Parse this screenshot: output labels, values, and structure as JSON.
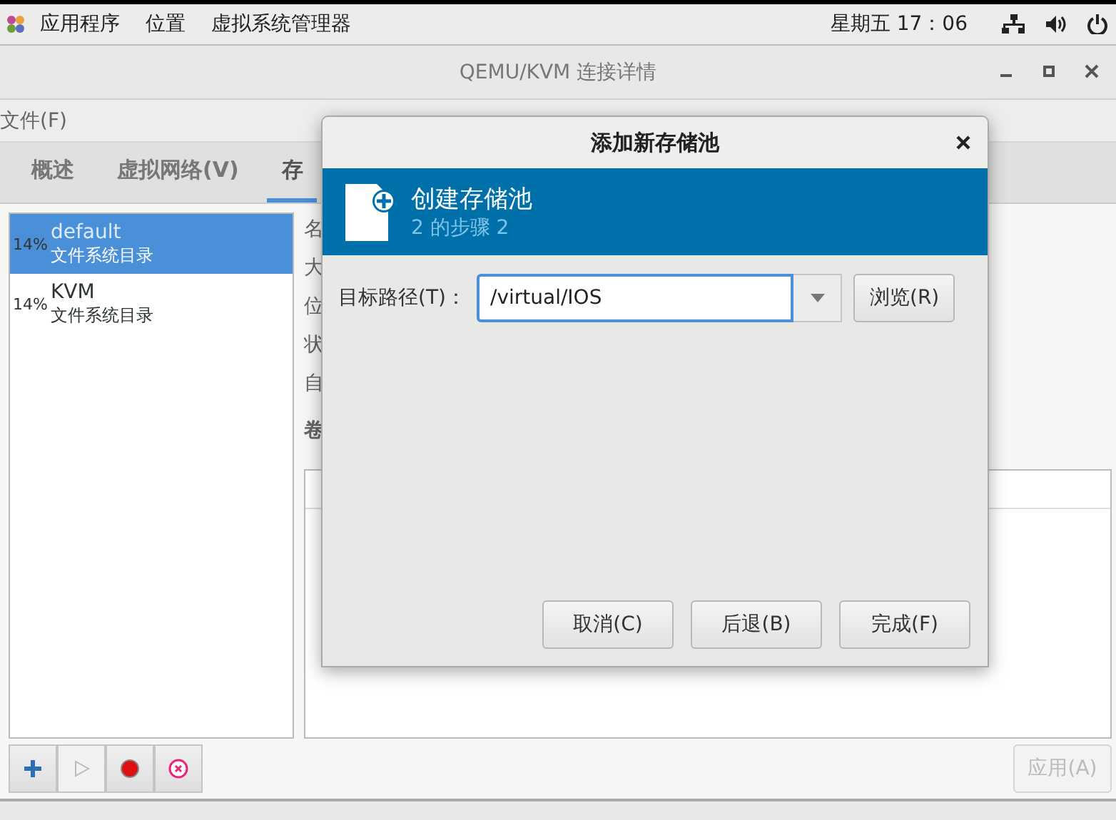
{
  "top_bar": {
    "menus": [
      "应用程序",
      "位置",
      "虚拟系统管理器"
    ],
    "clock": "星期五 17：06"
  },
  "window": {
    "title": "QEMU/KVM 连接详情"
  },
  "menu_bar": [
    "文件(F)"
  ],
  "tabs": [
    {
      "label": "概述",
      "selected": false
    },
    {
      "label": "虚拟网络(V)",
      "selected": false
    },
    {
      "label": "存",
      "selected": true
    }
  ],
  "pools": [
    {
      "usage": "14%",
      "name": "default",
      "type": "文件系统目录",
      "selected": true
    },
    {
      "usage": "14%",
      "name": "KVM",
      "type": "文件系统目录",
      "selected": false
    }
  ],
  "details": {
    "labels": [
      "名",
      "大",
      "位",
      "状",
      "自"
    ],
    "volumes_label": "卷"
  },
  "toolbar": [
    {
      "kind": "add",
      "disabled": false
    },
    {
      "kind": "start",
      "disabled": true
    },
    {
      "kind": "stop",
      "disabled": false
    },
    {
      "kind": "delete",
      "disabled": false
    }
  ],
  "apply_button": {
    "label": "应用(A)",
    "disabled": true
  },
  "dialog": {
    "title": "添加新存储池",
    "banner_title": "创建存储池",
    "banner_step": "2 的步骤 2",
    "field_label": "目标路径(T)：",
    "field_value": "/virtual/IOS",
    "browse_button": "浏览(R)",
    "buttons": [
      "取消(C)",
      "后退(B)",
      "完成(F)"
    ]
  }
}
